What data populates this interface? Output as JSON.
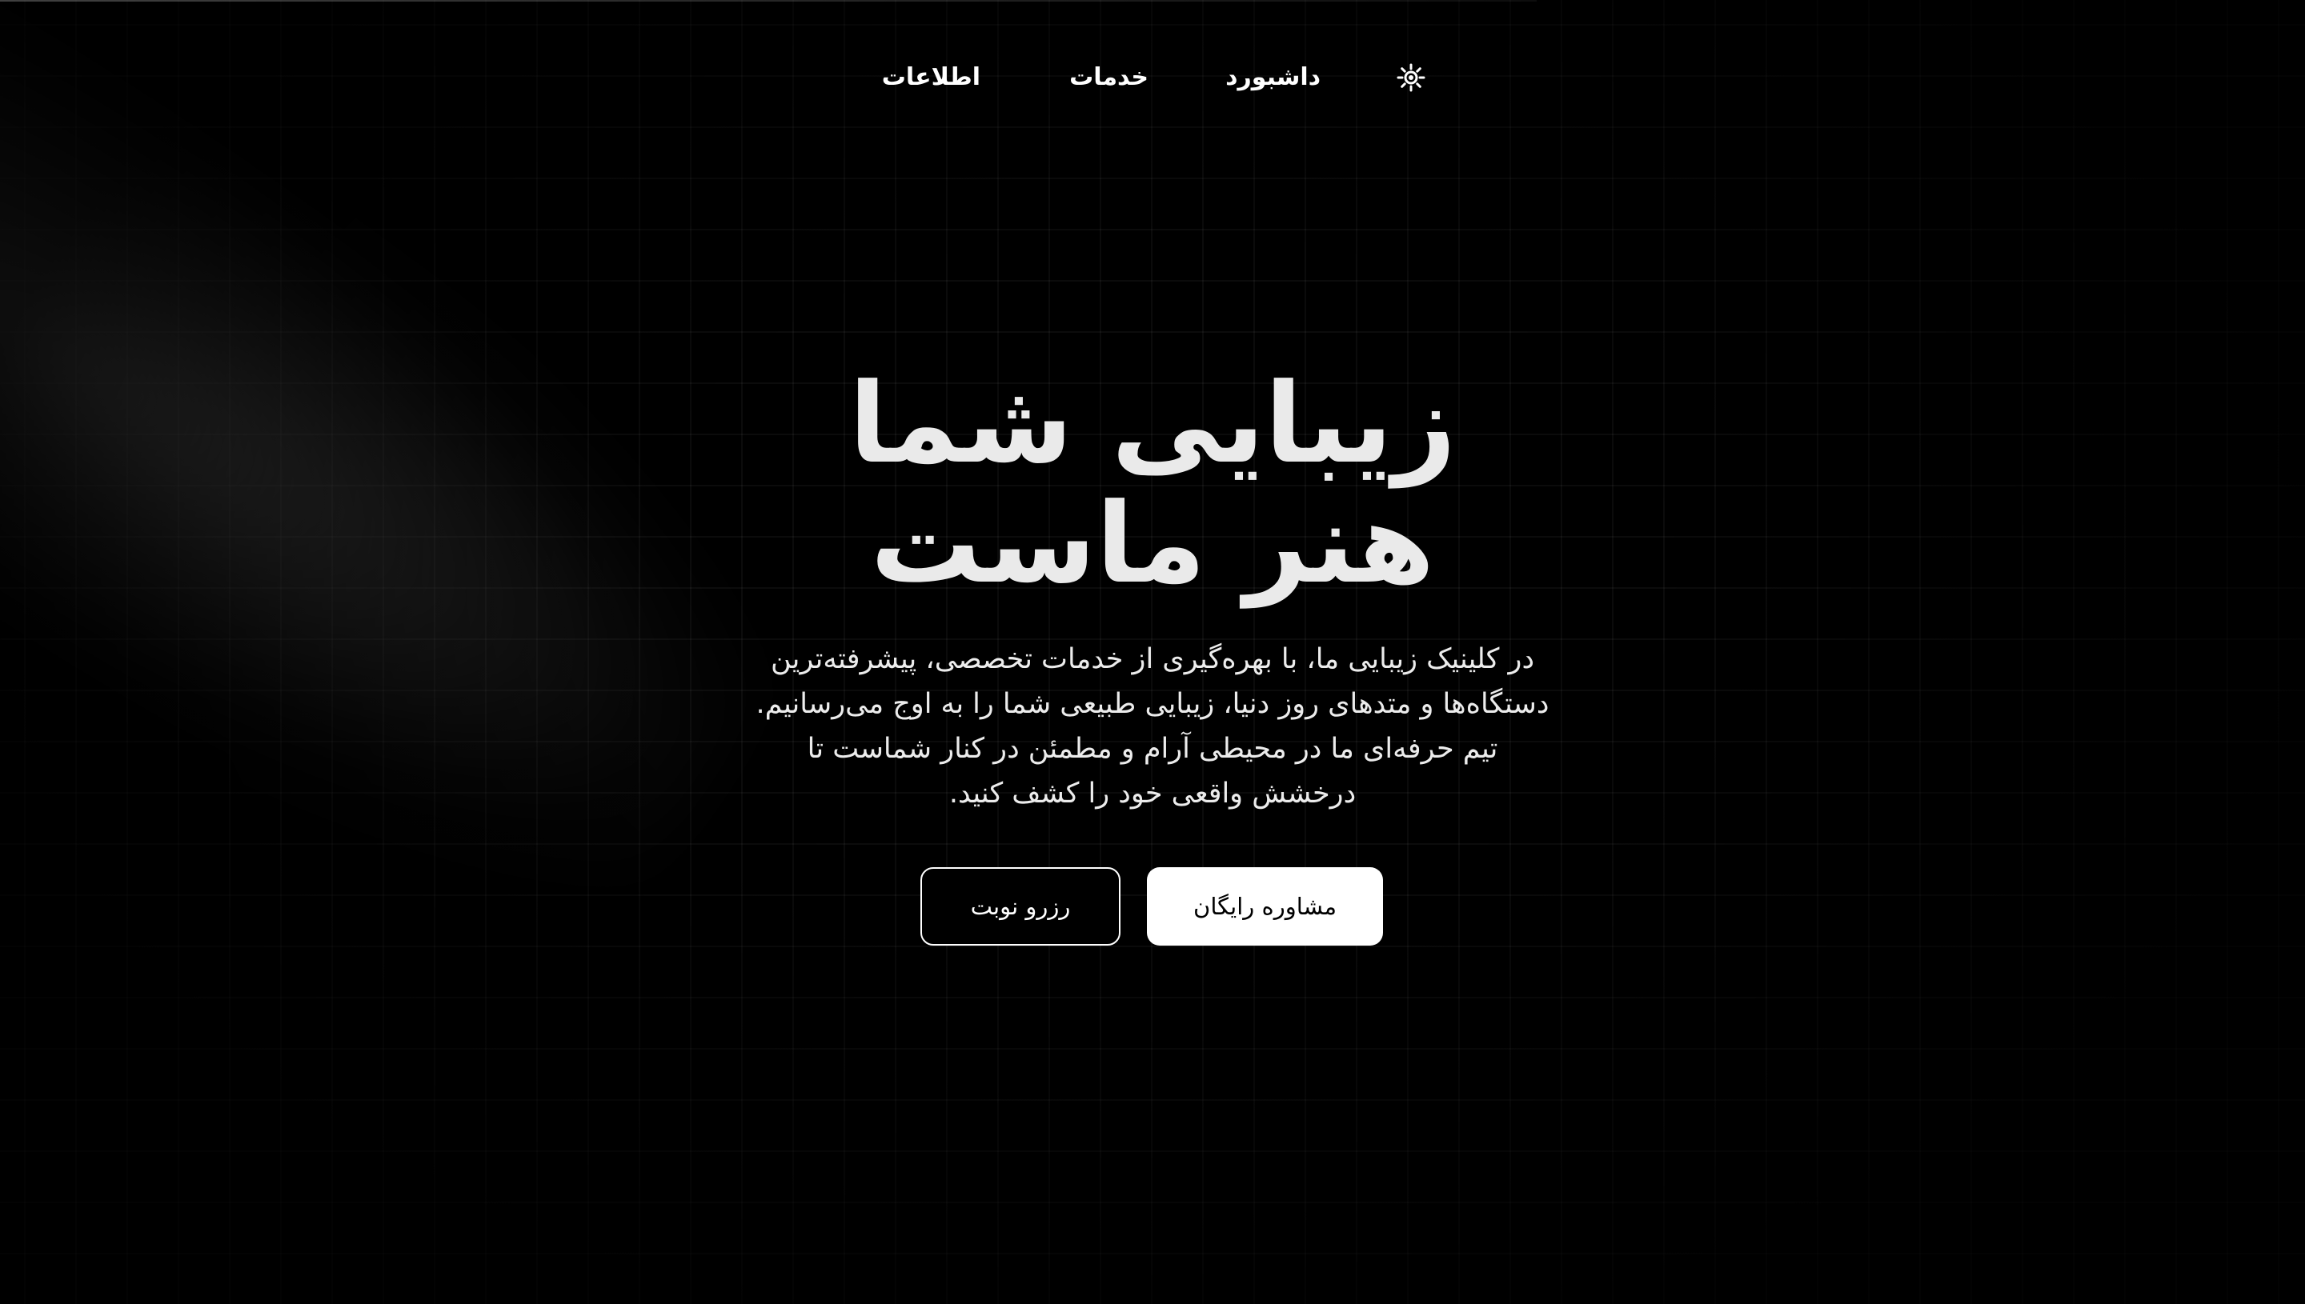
{
  "nav": {
    "items": [
      {
        "label": "اطلاعات"
      },
      {
        "label": "خدمات"
      },
      {
        "label": "داشبورد"
      }
    ],
    "theme_toggle_icon": "sun-icon"
  },
  "hero": {
    "title_line1": "زیبایی شما",
    "title_line2": "هنر ماست",
    "description_lines": [
      "در کلینیک زیبایی ما، با بهره‌گیری از خدمات تخصصی، پیشرفته‌ترین",
      "دستگاه‌ها و متدهای روز دنیا، زیبایی طبیعی شما را به اوج می‌رسانیم.",
      "تیم حرفه‌ای ما در محیطی آرام و مطمئن در کنار شماست تا",
      "درخشش واقعی خود را کشف کنید."
    ],
    "primary_button": "مشاوره رایگان",
    "secondary_button": "رزرو نوبت"
  },
  "colors": {
    "background": "#000000",
    "text": "#ffffff",
    "title": "#eaeaea"
  }
}
